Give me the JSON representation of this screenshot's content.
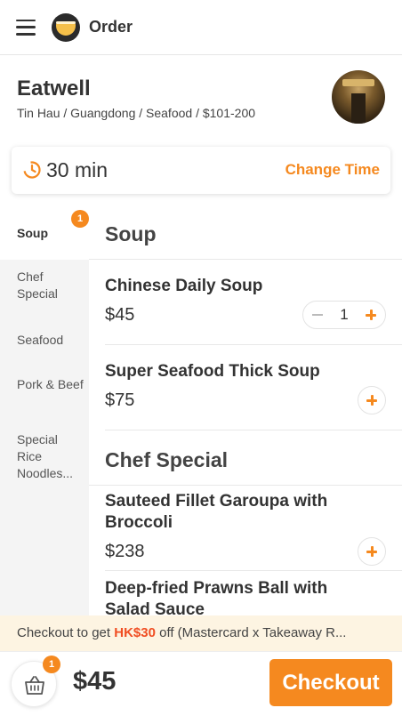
{
  "header": {
    "title": "Order",
    "menu_icon": "hamburger-icon",
    "logo_icon": "rice-bowl-logo"
  },
  "restaurant": {
    "name": "Eatwell",
    "meta": "Tin Hau / Guangdong / Seafood / $101-200",
    "photo": "restaurant-photo"
  },
  "pickup_time": {
    "value": "30 min",
    "change_label": "Change Time",
    "icon": "clock-icon"
  },
  "sidebar": {
    "items": [
      {
        "label": "Soup",
        "active": true,
        "badge": "1"
      },
      {
        "label": "Chef Special",
        "active": false
      },
      {
        "label": "Seafood",
        "active": false
      },
      {
        "label": "Pork & Beef",
        "active": false
      },
      {
        "label": "Special Rice Noodles...",
        "active": false
      }
    ]
  },
  "menu": {
    "sections": [
      {
        "title": "Soup",
        "items": [
          {
            "name": "Chinese Daily Soup",
            "price": "$45",
            "quantity": "1"
          },
          {
            "name": "Super Seafood Thick Soup",
            "price": "$75"
          }
        ]
      },
      {
        "title": "Chef Special",
        "items": [
          {
            "name": "Sauteed Fillet Garoupa with Broccoli",
            "price": "$238"
          },
          {
            "name": "Deep-fried Prawns Ball with Salad Sauce"
          }
        ]
      }
    ]
  },
  "promo": {
    "prefix": "Checkout to get ",
    "amount": "HK$30",
    "suffix": " off (Mastercard x Takeaway R..."
  },
  "cart": {
    "badge": "1",
    "total": "$45",
    "checkout_label": "Checkout",
    "icon": "basket-icon"
  },
  "colors": {
    "accent": "#f5891f",
    "promo_highlight": "#f04e23",
    "promo_background": "#fdf4e2"
  }
}
